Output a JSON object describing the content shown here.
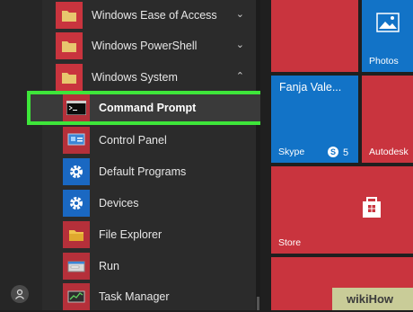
{
  "menu": {
    "groups": [
      {
        "label": "Windows Ease of Access",
        "chevron": "⌄"
      },
      {
        "label": "Windows PowerShell",
        "chevron": "⌄"
      },
      {
        "label": "Windows System",
        "chevron": "⌃"
      }
    ],
    "apps": [
      {
        "label": "Command Prompt",
        "icon": "command-prompt-icon"
      },
      {
        "label": "Control Panel",
        "icon": "control-panel-icon"
      },
      {
        "label": "Default Programs",
        "icon": "gear-icon"
      },
      {
        "label": "Devices",
        "icon": "gear-icon"
      },
      {
        "label": "File Explorer",
        "icon": "folder-icon"
      },
      {
        "label": "Run",
        "icon": "run-icon"
      },
      {
        "label": "Task Manager",
        "icon": "task-manager-icon"
      }
    ]
  },
  "tiles": {
    "photos": "Photos",
    "contact_name": "Fanja Vale...",
    "skype": "Skype",
    "skype_badge": "5",
    "autodesk": "Autodesk",
    "store": "Store"
  },
  "watermark": "wikiHow",
  "colors": {
    "highlight": "#3ee63a",
    "tile_red": "#c9343e",
    "tile_blue": "#1273c7"
  }
}
